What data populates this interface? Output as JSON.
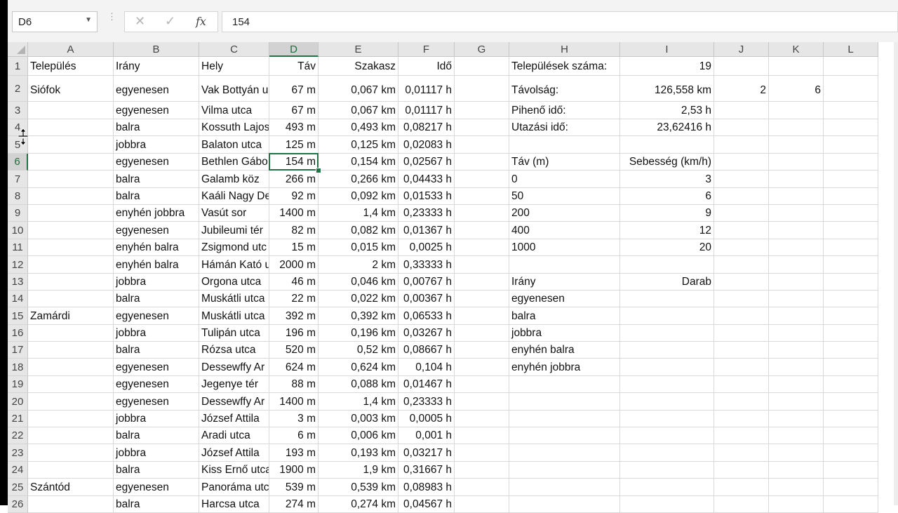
{
  "name_box": {
    "value": "D6",
    "dropdown_icon": "chevron-down-icon"
  },
  "formula_bar": {
    "cancel_icon": "cancel-x-icon",
    "enter_icon": "check-icon",
    "fx_label": "fx",
    "value": "154"
  },
  "columns": [
    "A",
    "B",
    "C",
    "D",
    "E",
    "F",
    "G",
    "H",
    "I",
    "J",
    "K",
    "L"
  ],
  "selected_column": "D",
  "selected_row": "6",
  "rows": [
    {
      "n": "1",
      "A": "Település",
      "B": "Irány",
      "C": "Hely",
      "D": "Táv",
      "E": "Szakasz",
      "F": "Idő",
      "G": "",
      "H": "Települések száma:",
      "I": "19",
      "J": "",
      "K": "",
      "L": ""
    },
    {
      "n": "2",
      "A": "Siófok",
      "B": "egyenesen",
      "C": "Vak Bottyán u",
      "D": "67 m",
      "E": "0,067 km",
      "F": "0,01117 h",
      "G": "",
      "H": "Távolság:",
      "I": "126,558 km",
      "J": "2",
      "K": "6",
      "L": ""
    },
    {
      "n": "3",
      "A": "",
      "B": "egyenesen",
      "C": "Vilma utca",
      "D": "67 m",
      "E": "0,067 km",
      "F": "0,01117 h",
      "G": "",
      "H": "Pihenő idő:",
      "I": "2,53 h",
      "J": "",
      "K": "",
      "L": ""
    },
    {
      "n": "4",
      "A": "",
      "B": "balra",
      "C": "Kossuth Lajos",
      "D": "493 m",
      "E": "0,493 km",
      "F": "0,08217 h",
      "G": "",
      "H": "Utazási idő:",
      "I": "23,62416 h",
      "J": "",
      "K": "",
      "L": ""
    },
    {
      "n": "5",
      "A": "",
      "B": "jobbra",
      "C": "Balaton utca",
      "D": "125 m",
      "E": "0,125 km",
      "F": "0,02083 h",
      "G": "",
      "H": "",
      "I": "",
      "J": "",
      "K": "",
      "L": ""
    },
    {
      "n": "6",
      "A": "",
      "B": "egyenesen",
      "C": "Bethlen Gábo",
      "D": "154 m",
      "E": "0,154 km",
      "F": "0,02567 h",
      "G": "",
      "H": "Táv (m)",
      "I": "Sebesség (km/h)",
      "J": "",
      "K": "",
      "L": ""
    },
    {
      "n": "7",
      "A": "",
      "B": "balra",
      "C": "Galamb köz",
      "D": "266 m",
      "E": "0,266 km",
      "F": "0,04433 h",
      "G": "",
      "H": "0",
      "I": "3",
      "J": "",
      "K": "",
      "L": ""
    },
    {
      "n": "8",
      "A": "",
      "B": "balra",
      "C": "Kaáli Nagy De",
      "D": "92 m",
      "E": "0,092 km",
      "F": "0,01533 h",
      "G": "",
      "H": "50",
      "I": "6",
      "J": "",
      "K": "",
      "L": ""
    },
    {
      "n": "9",
      "A": "",
      "B": "enyhén jobbra",
      "C": "Vasút sor",
      "D": "1400 m",
      "E": "1,4 km",
      "F": "0,23333 h",
      "G": "",
      "H": "200",
      "I": "9",
      "J": "",
      "K": "",
      "L": ""
    },
    {
      "n": "10",
      "A": "",
      "B": "egyenesen",
      "C": "Jubileumi tér",
      "D": "82 m",
      "E": "0,082 km",
      "F": "0,01367 h",
      "G": "",
      "H": "400",
      "I": "12",
      "J": "",
      "K": "",
      "L": ""
    },
    {
      "n": "11",
      "A": "",
      "B": "enyhén balra",
      "C": "Zsigmond utc",
      "D": "15 m",
      "E": "0,015 km",
      "F": "0,0025 h",
      "G": "",
      "H": "1000",
      "I": "20",
      "J": "",
      "K": "",
      "L": ""
    },
    {
      "n": "12",
      "A": "",
      "B": "enyhén balra",
      "C": "Hámán Kató u",
      "D": "2000 m",
      "E": "2 km",
      "F": "0,33333 h",
      "G": "",
      "H": "",
      "I": "",
      "J": "",
      "K": "",
      "L": ""
    },
    {
      "n": "13",
      "A": "",
      "B": "jobbra",
      "C": "Orgona utca",
      "D": "46 m",
      "E": "0,046 km",
      "F": "0,00767 h",
      "G": "",
      "H": "Irány",
      "I": "Darab",
      "J": "",
      "K": "",
      "L": ""
    },
    {
      "n": "14",
      "A": "",
      "B": "balra",
      "C": "Muskátli utca",
      "D": "22 m",
      "E": "0,022 km",
      "F": "0,00367 h",
      "G": "",
      "H": "egyenesen",
      "I": "",
      "J": "",
      "K": "",
      "L": ""
    },
    {
      "n": "15",
      "A": "Zamárdi",
      "B": "egyenesen",
      "C": "Muskátli utca",
      "D": "392 m",
      "E": "0,392 km",
      "F": "0,06533 h",
      "G": "",
      "H": "balra",
      "I": "",
      "J": "",
      "K": "",
      "L": ""
    },
    {
      "n": "16",
      "A": "",
      "B": "jobbra",
      "C": "Tulipán utca",
      "D": "196 m",
      "E": "0,196 km",
      "F": "0,03267 h",
      "G": "",
      "H": "jobbra",
      "I": "",
      "J": "",
      "K": "",
      "L": ""
    },
    {
      "n": "17",
      "A": "",
      "B": "balra",
      "C": "Rózsa utca",
      "D": "520 m",
      "E": "0,52 km",
      "F": "0,08667 h",
      "G": "",
      "H": "enyhén balra",
      "I": "",
      "J": "",
      "K": "",
      "L": ""
    },
    {
      "n": "18",
      "A": "",
      "B": "egyenesen",
      "C": "Dessewffy Ar",
      "D": "624 m",
      "E": "0,624 km",
      "F": "0,104 h",
      "G": "",
      "H": "enyhén jobbra",
      "I": "",
      "J": "",
      "K": "",
      "L": ""
    },
    {
      "n": "19",
      "A": "",
      "B": "egyenesen",
      "C": "Jegenye tér",
      "D": "88 m",
      "E": "0,088 km",
      "F": "0,01467 h",
      "G": "",
      "H": "",
      "I": "",
      "J": "",
      "K": "",
      "L": ""
    },
    {
      "n": "20",
      "A": "",
      "B": "egyenesen",
      "C": "Dessewffy Ar",
      "D": "1400 m",
      "E": "1,4 km",
      "F": "0,23333 h",
      "G": "",
      "H": "",
      "I": "",
      "J": "",
      "K": "",
      "L": ""
    },
    {
      "n": "21",
      "A": "",
      "B": "jobbra",
      "C": "József Attila",
      "D": "3 m",
      "E": "0,003 km",
      "F": "0,0005 h",
      "G": "",
      "H": "",
      "I": "",
      "J": "",
      "K": "",
      "L": ""
    },
    {
      "n": "22",
      "A": "",
      "B": "balra",
      "C": "Aradi utca",
      "D": "6 m",
      "E": "0,006 km",
      "F": "0,001 h",
      "G": "",
      "H": "",
      "I": "",
      "J": "",
      "K": "",
      "L": ""
    },
    {
      "n": "23",
      "A": "",
      "B": "jobbra",
      "C": "József Attila",
      "D": "193 m",
      "E": "0,193 km",
      "F": "0,03217 h",
      "G": "",
      "H": "",
      "I": "",
      "J": "",
      "K": "",
      "L": ""
    },
    {
      "n": "24",
      "A": "",
      "B": "balra",
      "C": "Kiss Ernő utca",
      "D": "1900 m",
      "E": "1,9 km",
      "F": "0,31667 h",
      "G": "",
      "H": "",
      "I": "",
      "J": "",
      "K": "",
      "L": ""
    },
    {
      "n": "25",
      "A": "Szántód",
      "B": "egyenesen",
      "C": "Panoráma utc",
      "D": "539 m",
      "E": "0,539 km",
      "F": "0,08983 h",
      "G": "",
      "H": "",
      "I": "",
      "J": "",
      "K": "",
      "L": ""
    },
    {
      "n": "26",
      "A": "",
      "B": "balra",
      "C": "Harcsa utca",
      "D": "274 m",
      "E": "0,274 km",
      "F": "0,04567 h",
      "G": "",
      "H": "",
      "I": "",
      "J": "",
      "K": "",
      "L": ""
    }
  ]
}
